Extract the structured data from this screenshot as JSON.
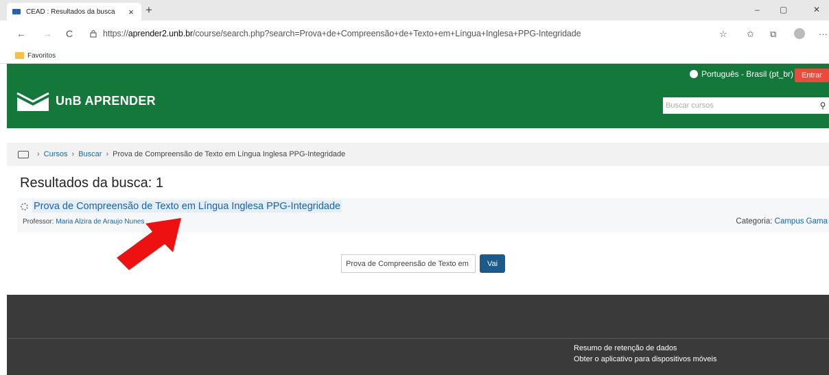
{
  "browser": {
    "tab_title": "CEAD : Resultados da busca",
    "tab_close": "×",
    "new_tab": "+",
    "url_prefix": "https://",
    "url_host": "aprender2.unb.br",
    "url_path": "/course/search.php?search=Prova+de+Compreensão+de+Texto+em+Língua+Inglesa+PPG-Integridade",
    "favorites_label": "Favoritos",
    "win_minimize": "–",
    "win_restore": "▢",
    "win_close": "✕",
    "nav_back": "←",
    "nav_forward": "→",
    "nav_reload": "C",
    "icon_fav_add": "☆",
    "icon_favorites": "✩",
    "icon_collections": "⧉",
    "icon_more": "···"
  },
  "site": {
    "language": "Português - Brasil (pt_br)",
    "login_label": "Entrar",
    "brand_name": "UnB APRENDER",
    "search_placeholder": "Buscar cursos",
    "search_icon_glyph": "⚲"
  },
  "breadcrumb": {
    "sep": "›",
    "items": [
      "Cursos",
      "Buscar",
      "Prova de Compreensão de Texto em Língua Inglesa PPG-Integridade"
    ]
  },
  "results": {
    "heading": "Resultados da busca: 1",
    "items": [
      {
        "title": "Prova de Compreensão de Texto em Língua Inglesa PPG-Integridade",
        "professor_label": "Professor:",
        "professor_name": "Maria Alzira de Araujo Nunes",
        "category_label": "Categoria:",
        "category_name": "Campus Gama"
      }
    ]
  },
  "bottom_search": {
    "value": "Prova de Compreensão de Texto em",
    "button_label": "Vai"
  },
  "footer": {
    "links": [
      "Resumo de retenção de dados",
      "Obter o aplicativo para dispositivos móveis"
    ]
  },
  "colors": {
    "brand_green": "#13783a",
    "login_red": "#e74c3c",
    "annotation_arrow": "#ee1111",
    "link_blue": "#1767a8"
  }
}
